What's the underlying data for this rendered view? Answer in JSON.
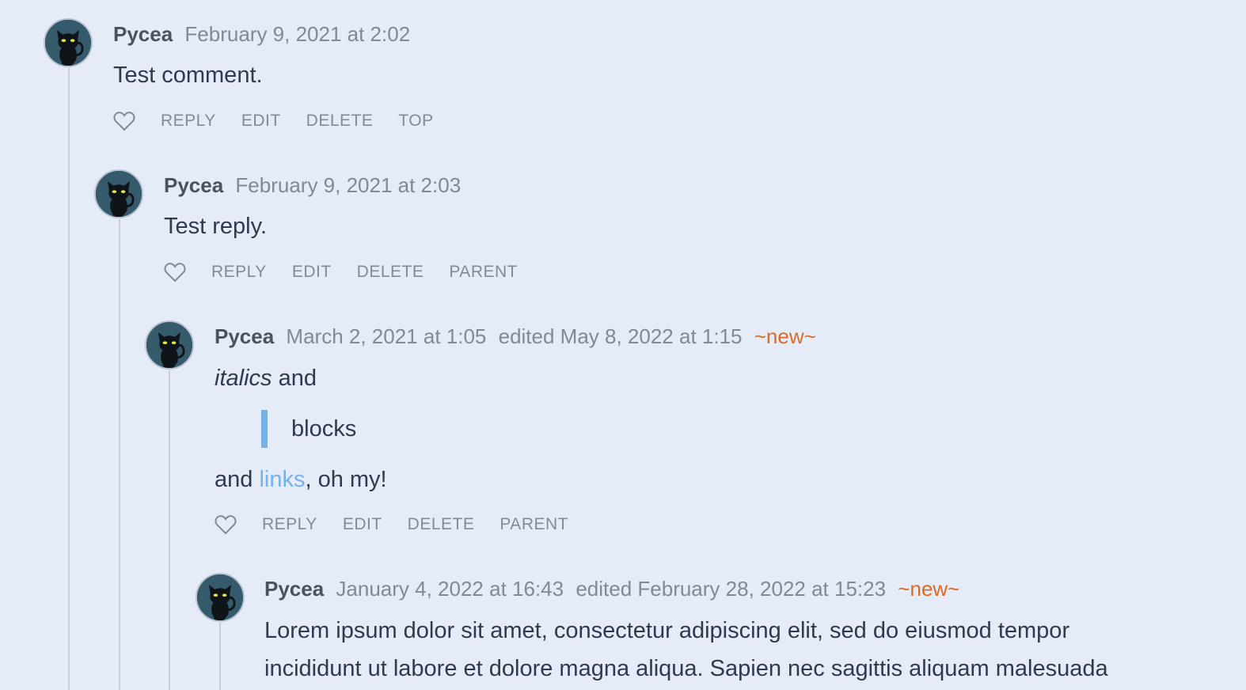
{
  "colors": {
    "background": "#e5ecf8",
    "accent_new": "#d96b26",
    "link": "#73b3ea",
    "quote_bar": "#73b3ea"
  },
  "comments": [
    {
      "author": "Pycea",
      "date": "February 9, 2021 at 2:02",
      "body": "Test comment.",
      "actions": {
        "like_icon": "heart-icon",
        "reply": "REPLY",
        "edit": "EDIT",
        "delete": "DELETE",
        "nav": "TOP"
      }
    },
    {
      "author": "Pycea",
      "date": "February 9, 2021 at 2:03",
      "body": "Test reply.",
      "actions": {
        "like_icon": "heart-icon",
        "reply": "REPLY",
        "edit": "EDIT",
        "delete": "DELETE",
        "nav": "PARENT"
      }
    },
    {
      "author": "Pycea",
      "date": "March 2, 2021 at 1:05",
      "edited": "edited May 8, 2022 at 1:15",
      "badge": "~new~",
      "body_line1_italic": "italics",
      "body_line1_rest": " and",
      "quote": "blocks",
      "body_line3_start": "and ",
      "body_line3_link": "links",
      "body_line3_end": ", oh my!",
      "actions": {
        "like_icon": "heart-icon",
        "reply": "REPLY",
        "edit": "EDIT",
        "delete": "DELETE",
        "nav": "PARENT"
      }
    },
    {
      "author": "Pycea",
      "date": "January 4, 2022 at 16:43",
      "edited": "edited February 28, 2022 at 15:23",
      "badge": "~new~",
      "body_line1": "Lorem ipsum dolor sit amet, consectetur adipiscing elit, sed do eiusmod tempor",
      "body_line2": "incididunt ut labore et dolore magna aliqua. Sapien nec sagittis aliquam malesuada"
    }
  ]
}
